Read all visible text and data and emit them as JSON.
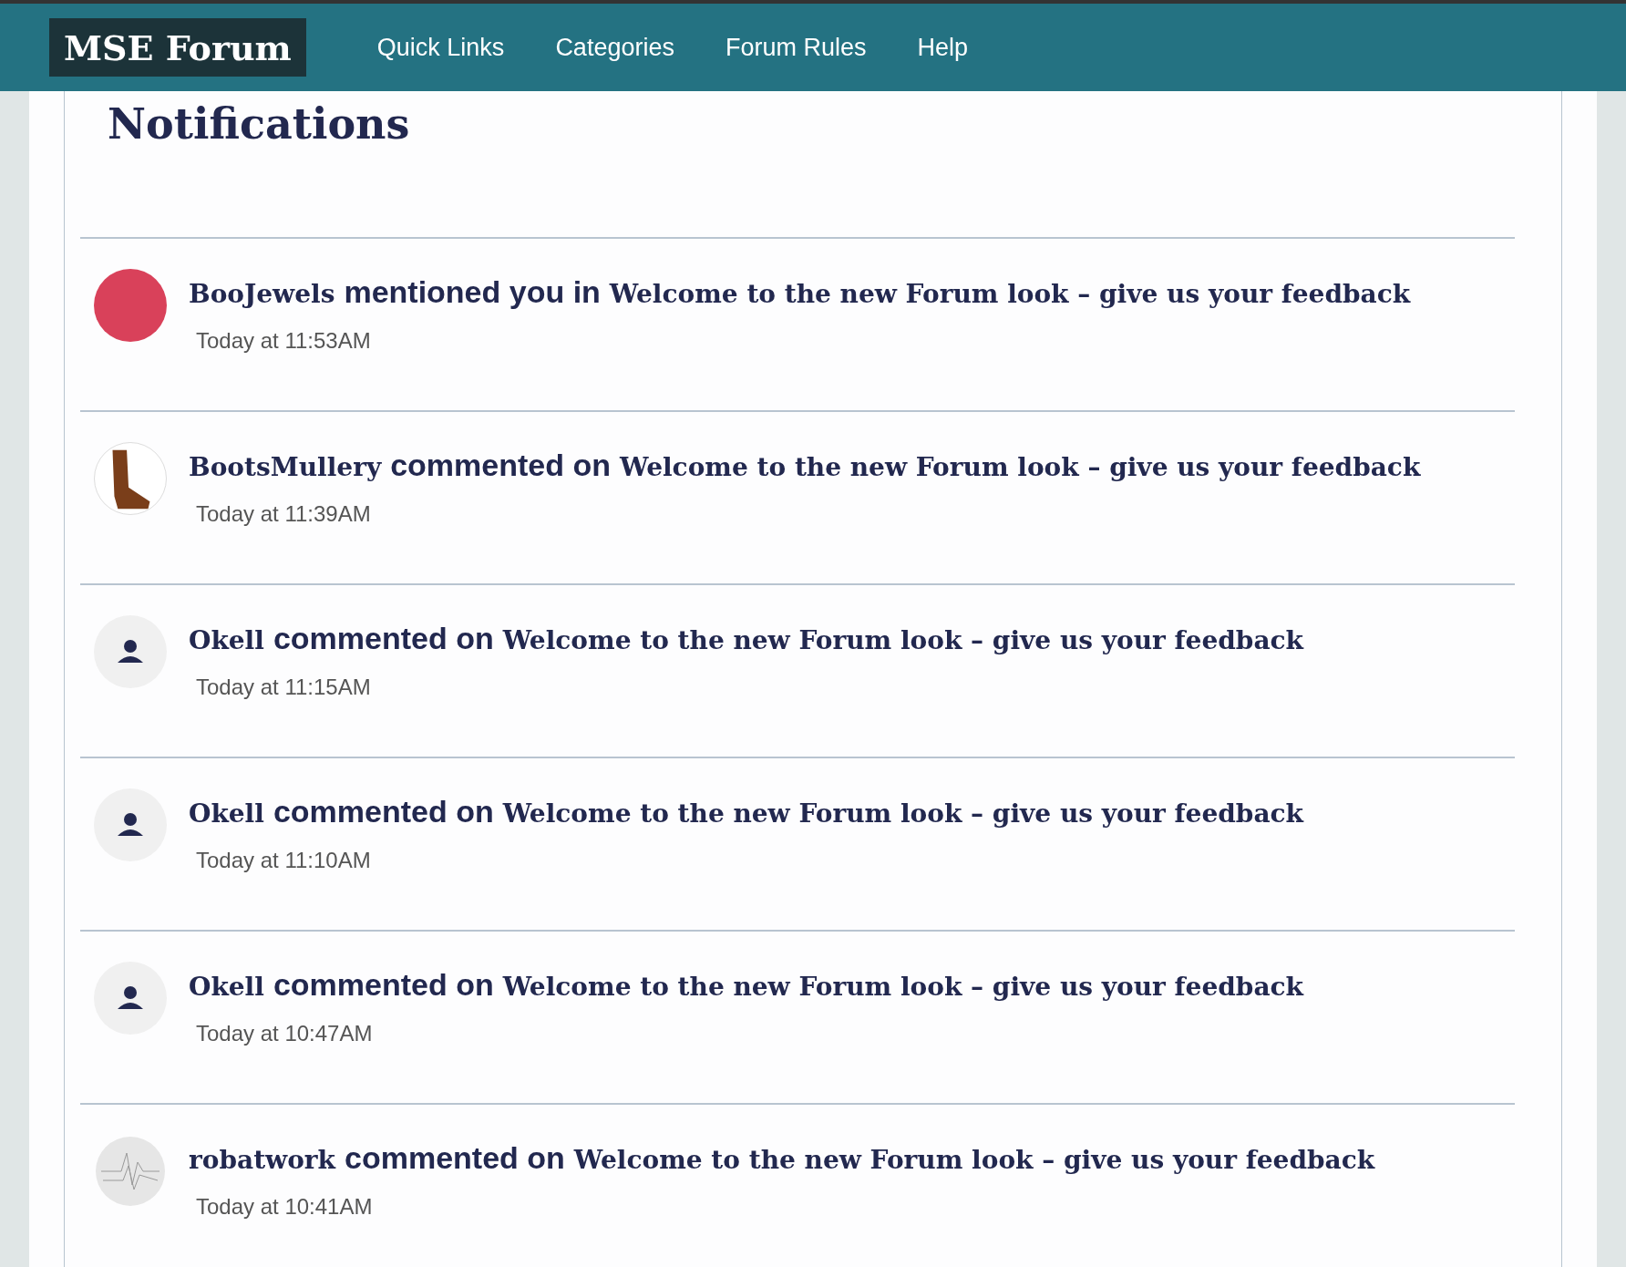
{
  "header": {
    "logo": "MSE Forum",
    "nav": [
      "Quick Links",
      "Categories",
      "Forum Rules",
      "Help"
    ]
  },
  "page_title": "Notifications",
  "notifications": [
    {
      "kind": "photo",
      "user": "BooJewels",
      "action": "mentioned you in",
      "topic": "Welcome to the new Forum look – give us your feedback",
      "time": "Today at 11:53AM"
    },
    {
      "kind": "boot",
      "user": "BootsMullery",
      "action": "commented on",
      "topic": "Welcome to the new Forum look – give us your feedback",
      "time": "Today at 11:39AM"
    },
    {
      "kind": "default",
      "user": "Okell",
      "action": "commented on",
      "topic": "Welcome to the new Forum look – give us your feedback",
      "time": "Today at 11:15AM"
    },
    {
      "kind": "default",
      "user": "Okell",
      "action": "commented on",
      "topic": "Welcome to the new Forum look – give us your feedback",
      "time": "Today at 11:10AM"
    },
    {
      "kind": "default",
      "user": "Okell",
      "action": "commented on",
      "topic": "Welcome to the new Forum look – give us your feedback",
      "time": "Today at 10:47AM"
    },
    {
      "kind": "waves",
      "user": "robatwork",
      "action": "commented on",
      "topic": "Welcome to the new Forum look – give us your feedback",
      "time": "Today at 10:41AM"
    }
  ]
}
